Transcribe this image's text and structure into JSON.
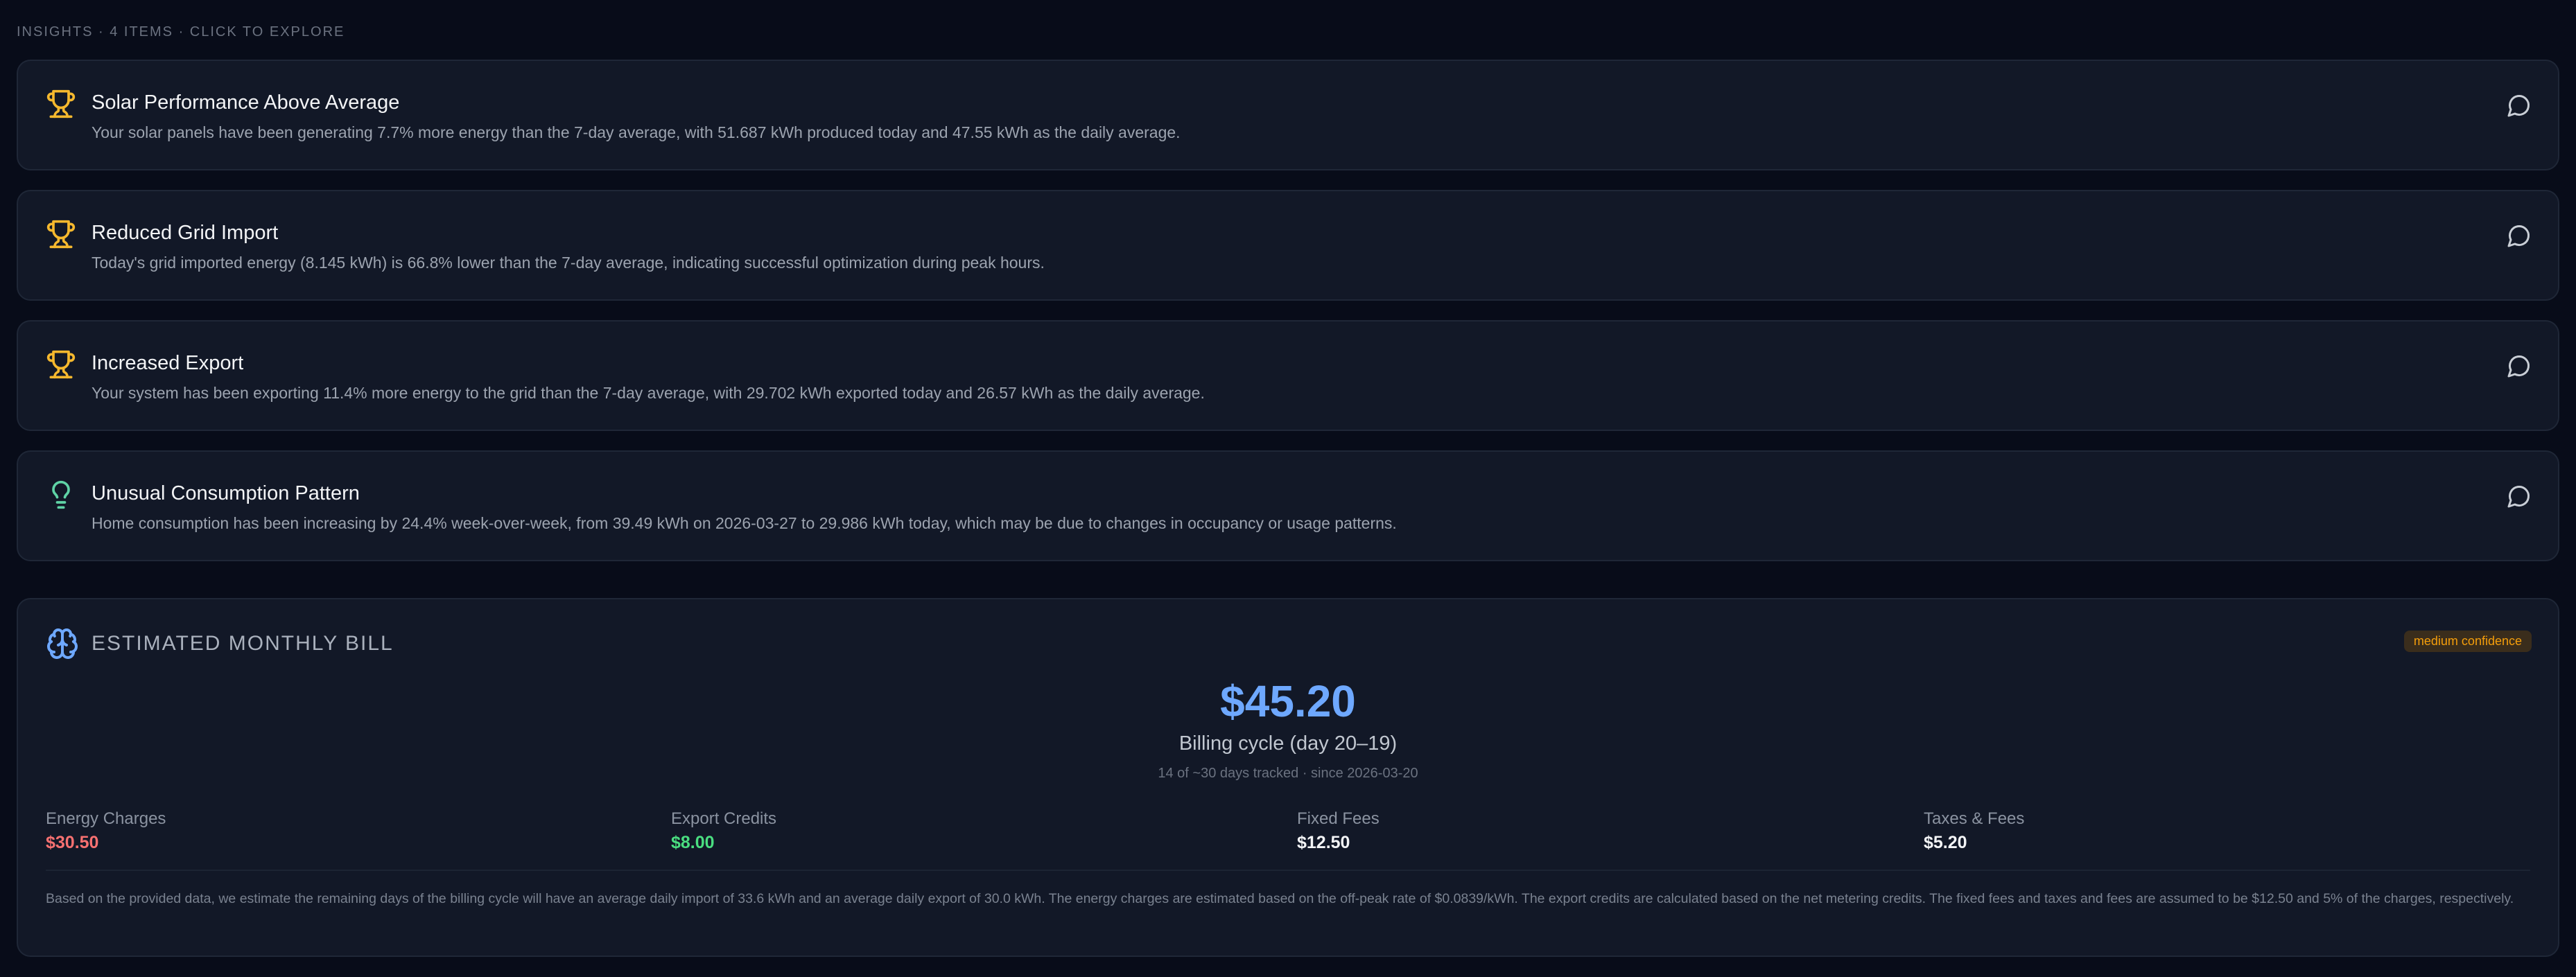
{
  "header": {
    "label": "INSIGHTS · 4 ITEMS · CLICK TO EXPLORE"
  },
  "insights": [
    {
      "icon": "trophy-icon",
      "title": "Solar Performance Above Average",
      "description": "Your solar panels have been generating 7.7% more energy than the 7-day average, with 51.687 kWh produced today and 47.55 kWh as the daily average."
    },
    {
      "icon": "trophy-icon",
      "title": "Reduced Grid Import",
      "description": "Today's grid imported energy (8.145 kWh) is 66.8% lower than the 7-day average, indicating successful optimization during peak hours."
    },
    {
      "icon": "trophy-icon",
      "title": "Increased Export",
      "description": "Your system has been exporting 11.4% more energy to the grid than the 7-day average, with 29.702 kWh exported today and 26.57 kWh as the daily average."
    },
    {
      "icon": "lightbulb-icon",
      "title": "Unusual Consumption Pattern",
      "description": "Home consumption has been increasing by 24.4% week-over-week, from 39.49 kWh on 2026-03-27 to 29.986 kWh today, which may be due to changes in occupancy or usage patterns."
    }
  ],
  "bill": {
    "icon": "brain-icon",
    "title": "ESTIMATED MONTHLY BILL",
    "confidence": "medium confidence",
    "amount": "$45.20",
    "cycle": "Billing cycle (day 20–19)",
    "tracked": "14 of ~30 days tracked · since 2026-03-20",
    "breakdown": [
      {
        "label": "Energy Charges",
        "value": "$30.50",
        "color": "#f87171"
      },
      {
        "label": "Export Credits",
        "value": "$8.00",
        "color": "#4ade80"
      },
      {
        "label": "Fixed Fees",
        "value": "$12.50",
        "color": "#f3f4f6"
      },
      {
        "label": "Taxes & Fees",
        "value": "$5.20",
        "color": "#f3f4f6"
      }
    ],
    "note": "Based on the provided data, we estimate the remaining days of the billing cycle will have an average daily import of 33.6 kWh and an average daily export of 30.0 kWh. The energy charges are estimated based on the off-peak rate of $0.0839/kWh. The export credits are calculated based on the net metering credits. The fixed fees and taxes and fees are assumed to be $12.50 and 5% of the charges, respectively."
  },
  "colors": {
    "background": "#080c19",
    "card": "#121827",
    "trophy": "#f5b82e",
    "lightbulb": "#5fd3a6",
    "brain": "#6ea8ff",
    "amount": "#6ea8ff",
    "confidence_text": "#f59e0b"
  }
}
